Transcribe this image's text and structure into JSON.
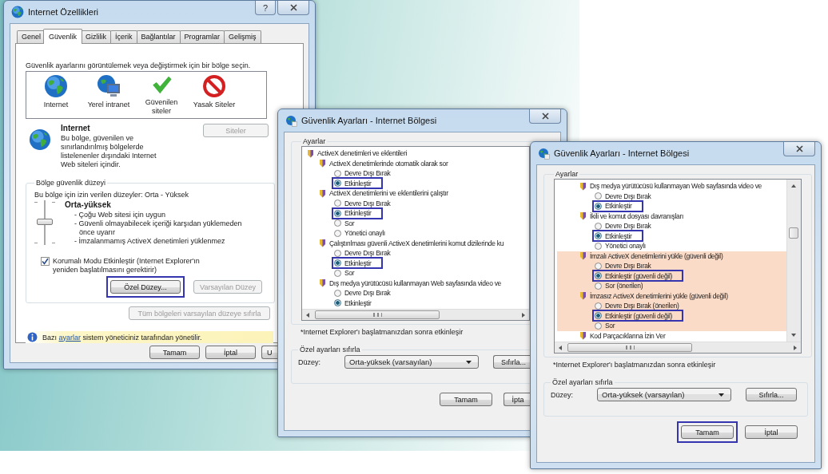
{
  "options_window": {
    "title": "Internet Özellikleri",
    "help_button": "?",
    "tabs": [
      {
        "label": "Genel",
        "selected": false
      },
      {
        "label": "Güvenlik",
        "selected": true
      },
      {
        "label": "Gizlilik",
        "selected": false
      },
      {
        "label": "İçerik",
        "selected": false
      },
      {
        "label": "Bağlantılar",
        "selected": false
      },
      {
        "label": "Programlar",
        "selected": false
      },
      {
        "label": "Gelişmiş",
        "selected": false
      }
    ],
    "zone_prompt": "Güvenlik ayarlarını görüntülemek veya değiştirmek için bir bölge seçin.",
    "zones": [
      {
        "label": "Internet",
        "kind": "globe"
      },
      {
        "label": "Yerel intranet",
        "kind": "intranet"
      },
      {
        "label": "Güvenilen siteler",
        "kind": "trusted"
      },
      {
        "label": "Yasak Siteler",
        "kind": "restricted"
      }
    ],
    "zone_name": "Internet",
    "zone_description": "Bu bölge, güvenilen ve sınırlandırılmış bölgelerde listelenenler dışındaki Internet Web siteleri içindir.",
    "sites_button": {
      "label": "Siteler",
      "disabled": true
    },
    "level_group": {
      "title": "Bölge güvenlik düzeyi",
      "allowed": "Bu bölge için izin verilen düzeyler: Orta - Yüksek",
      "level": 0.5,
      "level_name": "Orta-yüksek",
      "bullets": [
        "- Çoğu Web sitesi için uygun",
        "- Güvenli olmayabilecek içeriği karşıdan yüklemeden önce uyarır",
        "- İmzalanmamış ActiveX denetimleri yüklenmez"
      ],
      "protected_mode": {
        "label": "Korumalı Modu Etkinleştir (Internet Explorer'ın yeniden başlatılmasını gerektirir)",
        "checked": true
      },
      "buttons": [
        {
          "label": "Özel Düzey...",
          "disabled": false,
          "highlighted": true
        },
        {
          "label": "Varsayılan Düzey",
          "disabled": true,
          "highlighted": false
        }
      ]
    },
    "reset_all_button": {
      "label": "Tüm bölgeleri varsayılan düzeye sıfırla",
      "disabled": true
    },
    "notice": {
      "before": "Bazı",
      "link": "ayarlar",
      "after": "sistem yöneticiniz tarafından yönetilir."
    },
    "buttons": [
      {
        "label": "Tamam"
      },
      {
        "label": "İptal"
      },
      {
        "label": "U"
      }
    ]
  },
  "security_windows": [
    {
      "title": "Güvenlik Ayarları - Internet Bölgesi",
      "group_title": "Ayarlar",
      "tree": [
        {
          "kind": "category",
          "label": "ActiveX denetimleri ve eklentileri",
          "children": [
            {
              "kind": "setting",
              "label": "ActiveX denetimlerinde otomatik olarak sor",
              "warning": false,
              "options": [
                {
                  "label": "Devre Dışı Bırak",
                  "selected": false,
                  "highlighted": false
                },
                {
                  "label": "Etkinleştir",
                  "selected": true,
                  "highlighted": true
                }
              ]
            },
            {
              "kind": "setting",
              "label": "ActiveX denetimlerini ve eklentilerini çalıştır",
              "warning": false,
              "options": [
                {
                  "label": "Devre Dışı Bırak",
                  "selected": false,
                  "highlighted": false
                },
                {
                  "label": "Etkinleştir",
                  "selected": true,
                  "highlighted": true
                },
                {
                  "label": "Sor",
                  "selected": false,
                  "highlighted": false
                },
                {
                  "label": "Yönetici onaylı",
                  "selected": false,
                  "highlighted": false
                }
              ]
            },
            {
              "kind": "setting",
              "label": "Çalıştırılması güvenli ActiveX denetimlerini komut dizilerinde ku",
              "warning": false,
              "options": [
                {
                  "label": "Devre Dışı Bırak",
                  "selected": false,
                  "highlighted": false
                },
                {
                  "label": "Etkinleştir",
                  "selected": true,
                  "highlighted": true
                },
                {
                  "label": "Sor",
                  "selected": false,
                  "highlighted": false
                }
              ]
            },
            {
              "kind": "setting",
              "label": "Dış medya yürütücüsü kullanmayan Web sayfasında video ve",
              "warning": false,
              "options": [
                {
                  "label": "Devre Dışı Bırak",
                  "selected": false,
                  "highlighted": false
                },
                {
                  "label": "Etkinleştir",
                  "selected": true,
                  "highlighted": false
                }
              ]
            }
          ]
        }
      ],
      "footnote": "*Internet Explorer'ı başlatmanızdan sonra etkinleşir",
      "reset_group": {
        "title": "Özel ayarları sıfırla",
        "level_label": "Düzey:",
        "dropdown": "Orta-yüksek (varsayılan)",
        "button": "Sıfırla..."
      },
      "buttons": [
        {
          "label": "Tamam",
          "highlighted": false
        },
        {
          "label": "İpta",
          "highlighted": false
        }
      ]
    },
    {
      "title": "Güvenlik Ayarları - Internet Bölgesi",
      "group_title": "Ayarlar",
      "tree": [
        {
          "kind": "setting",
          "label": "Dış medya yürütücüsü kullanmayan Web sayfasında video ve",
          "warning": false,
          "options": [
            {
              "label": "Devre Dışı Bırak",
              "selected": false,
              "highlighted": false
            },
            {
              "label": "Etkinleştir",
              "selected": true,
              "highlighted": true
            }
          ]
        },
        {
          "kind": "setting",
          "label": "İkili ve komut dosyası davranışları",
          "warning": false,
          "options": [
            {
              "label": "Devre Dışı Bırak",
              "selected": false,
              "highlighted": false
            },
            {
              "label": "Etkinleştir",
              "selected": true,
              "highlighted": true
            },
            {
              "label": "Yönetici onaylı",
              "selected": false,
              "highlighted": false
            }
          ]
        },
        {
          "kind": "setting",
          "label": "İmzalı ActiveX denetimlerini yükle (güvenli değil)",
          "warning": true,
          "options": [
            {
              "label": "Devre Dışı Bırak",
              "selected": false,
              "highlighted": false
            },
            {
              "label": "Etkinleştir (güvenli değil)",
              "selected": true,
              "highlighted": true
            },
            {
              "label": "Sor (önerilen)",
              "selected": false,
              "highlighted": false
            }
          ]
        },
        {
          "kind": "setting",
          "label": "İmzasız ActiveX denetimlerini yükle (güvenli değil)",
          "warning": true,
          "options": [
            {
              "label": "Devre Dışı Bırak (önerilen)",
              "selected": false,
              "highlighted": false
            },
            {
              "label": "Etkinleştir (güvenli değil)",
              "selected": true,
              "highlighted": true
            },
            {
              "label": "Sor",
              "selected": false,
              "highlighted": false
            }
          ]
        },
        {
          "kind": "setting",
          "label": "Kod Parçacıklarına İzin Ver",
          "warning": false
        }
      ],
      "footnote": "*Internet Explorer'ı başlatmanızdan sonra etkinleşir",
      "reset_group": {
        "title": "Özel ayarları sıfırla",
        "level_label": "Düzey:",
        "dropdown": "Orta-yüksek (varsayılan)",
        "button": "Sıfırla..."
      },
      "buttons": [
        {
          "label": "Tamam",
          "highlighted": true
        },
        {
          "label": "İptal",
          "highlighted": false
        }
      ]
    }
  ]
}
